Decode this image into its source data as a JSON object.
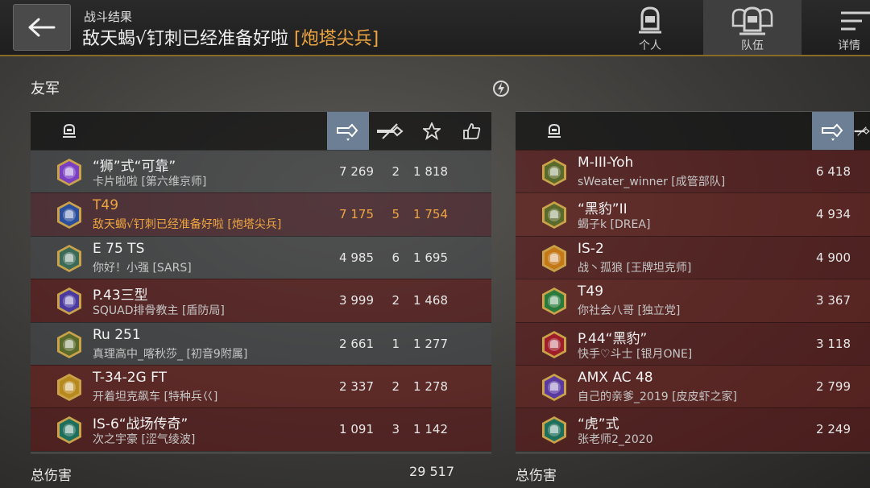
{
  "header": {
    "subtitle": "战斗结果",
    "title": "敌天蝎√钉刺已经准备好啦",
    "title_tag": "[炮塔尖兵]",
    "tabs": [
      {
        "label": "个人",
        "icon": "personal-helmet-icon",
        "active": false
      },
      {
        "label": "队伍",
        "icon": "team-helmets-icon",
        "active": true
      },
      {
        "label": "详情",
        "icon": "details-menu-icon",
        "active": false
      }
    ]
  },
  "allies": {
    "label": "友军",
    "total_label": "总伤害",
    "total": "29 517",
    "columns": [
      "tank-icon",
      "damage-icon",
      "kills-icon",
      "score-star-icon",
      "like-icon"
    ],
    "rows": [
      {
        "vehicle": "“狮”式“可靠”",
        "player": "卡片啦啦 [第六维京师]",
        "damage": "7 269",
        "kills": "2",
        "score": "1 818",
        "badge_color": "#7a3fc2",
        "tone": "tone-a"
      },
      {
        "vehicle": "T49",
        "player": "敌天蝎√钉刺已经准备好啦 [炮塔尖兵]",
        "damage": "7 175",
        "kills": "5",
        "score": "1 754",
        "badge_color": "#2b4f9c",
        "tone": "self"
      },
      {
        "vehicle": "E 75 TS",
        "player": "你好！小强 [SARS]",
        "damage": "4 985",
        "kills": "6",
        "score": "1 695",
        "badge_color": "#3c6a58",
        "tone": "tone-a"
      },
      {
        "vehicle": "P.43三型",
        "player": "SQUAD排骨教主 [盾防局]",
        "damage": "3 999",
        "kills": "2",
        "score": "1 468",
        "badge_color": "#4a3aa0",
        "tone": "tone-b"
      },
      {
        "vehicle": "Ru 251",
        "player": "真理高中_喀秋莎_ [初音9附属]",
        "damage": "2 661",
        "kills": "1",
        "score": "1 277",
        "badge_color": "#5a6a2a",
        "tone": "tone-a"
      },
      {
        "vehicle": "T-34-2G FT",
        "player": "开着坦克飙车 [特种兵巜]",
        "damage": "2 337",
        "kills": "2",
        "score": "1 278",
        "badge_color": "#b88a1e",
        "tone": "tone-c"
      },
      {
        "vehicle": "IS-6“战场传奇”",
        "player": "次之宇豪 [涩气绫波]",
        "damage": "1 091",
        "kills": "3",
        "score": "1 142",
        "badge_color": "#1d6e5a",
        "tone": "tone-b"
      }
    ]
  },
  "enemies": {
    "total_label": "总伤害",
    "columns": [
      "tank-icon",
      "damage-icon",
      "kills-icon"
    ],
    "rows": [
      {
        "vehicle": "M-III-Yoh",
        "player": "sWeater_winner [成管部队]",
        "damage": "6 418",
        "badge_color": "#5a6a2a",
        "tone": "tone-b"
      },
      {
        "vehicle": "“黑豹”II",
        "player": "蝎子k [DREA]",
        "damage": "4 934",
        "badge_color": "#5a6a2a",
        "tone": "tone-c"
      },
      {
        "vehicle": "IS-2",
        "player": "战丶孤狼 [王牌坦克师]",
        "damage": "4 900",
        "badge_color": "#c47818",
        "tone": "tone-b"
      },
      {
        "vehicle": "T49",
        "player": "你社会八哥 [独立党]",
        "damage": "3 367",
        "badge_color": "#2a7a3c",
        "tone": "tone-c"
      },
      {
        "vehicle": "P.44“黑豹”",
        "player": "快手♡斗士 [银月ONE]",
        "damage": "3 118",
        "badge_color": "#a01e2a",
        "tone": "tone-b"
      },
      {
        "vehicle": "AMX AC 48",
        "player": "自己的亲爹_2019 [皮皮虾之家]",
        "damage": "2 799",
        "badge_color": "#5a3aa0",
        "tone": "tone-c"
      },
      {
        "vehicle": "“虎”式",
        "player": "张老师2_2020",
        "damage": "2 249",
        "badge_color": "#1d6e5a",
        "tone": "tone-b"
      }
    ]
  }
}
